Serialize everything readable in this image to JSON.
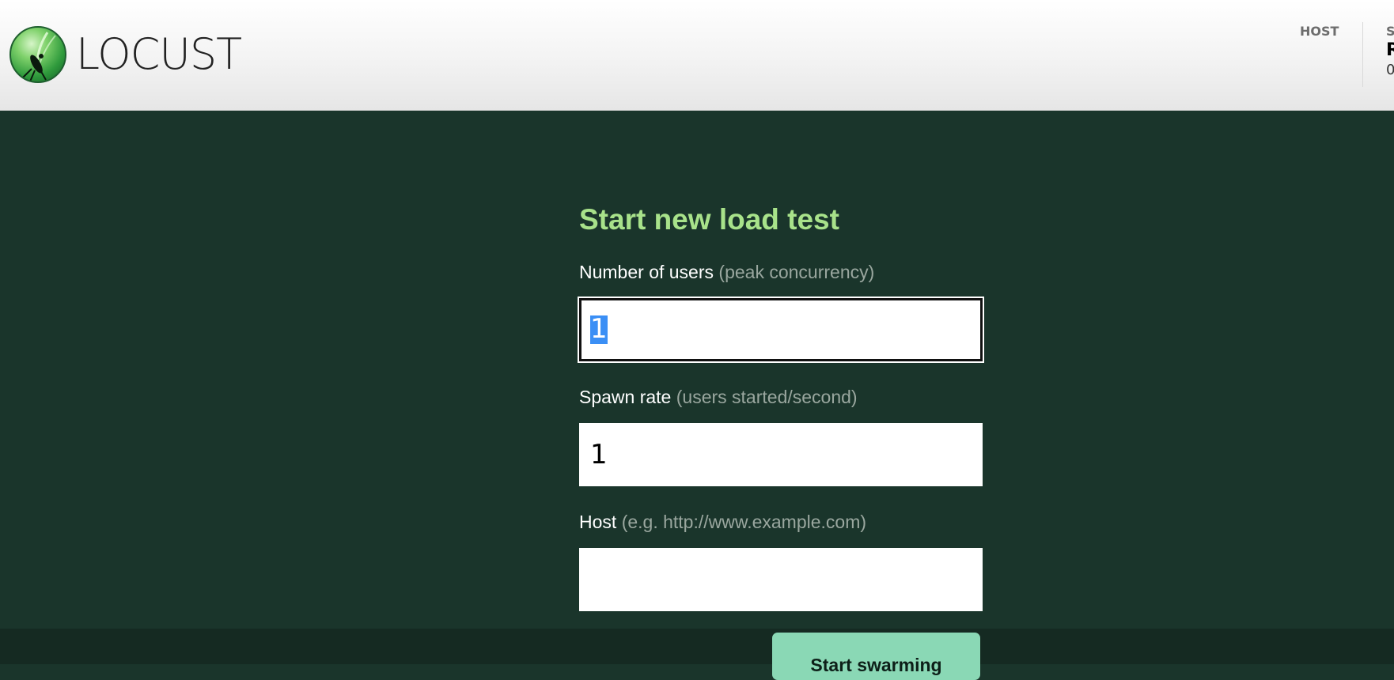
{
  "header": {
    "logo_text": "LOCUST",
    "host_label": "HOST",
    "status_label": "STATUS",
    "status_value": "READY",
    "status_sub": "0"
  },
  "form": {
    "title": "Start new load test",
    "users": {
      "label": "Number of users",
      "hint": "(peak concurrency)",
      "value": "1"
    },
    "spawn_rate": {
      "label": "Spawn rate",
      "hint": "(users started/second)",
      "value": "1"
    },
    "host": {
      "label": "Host",
      "hint": "(e.g. http://www.example.com)",
      "value": ""
    },
    "submit_label": "Start swarming"
  }
}
